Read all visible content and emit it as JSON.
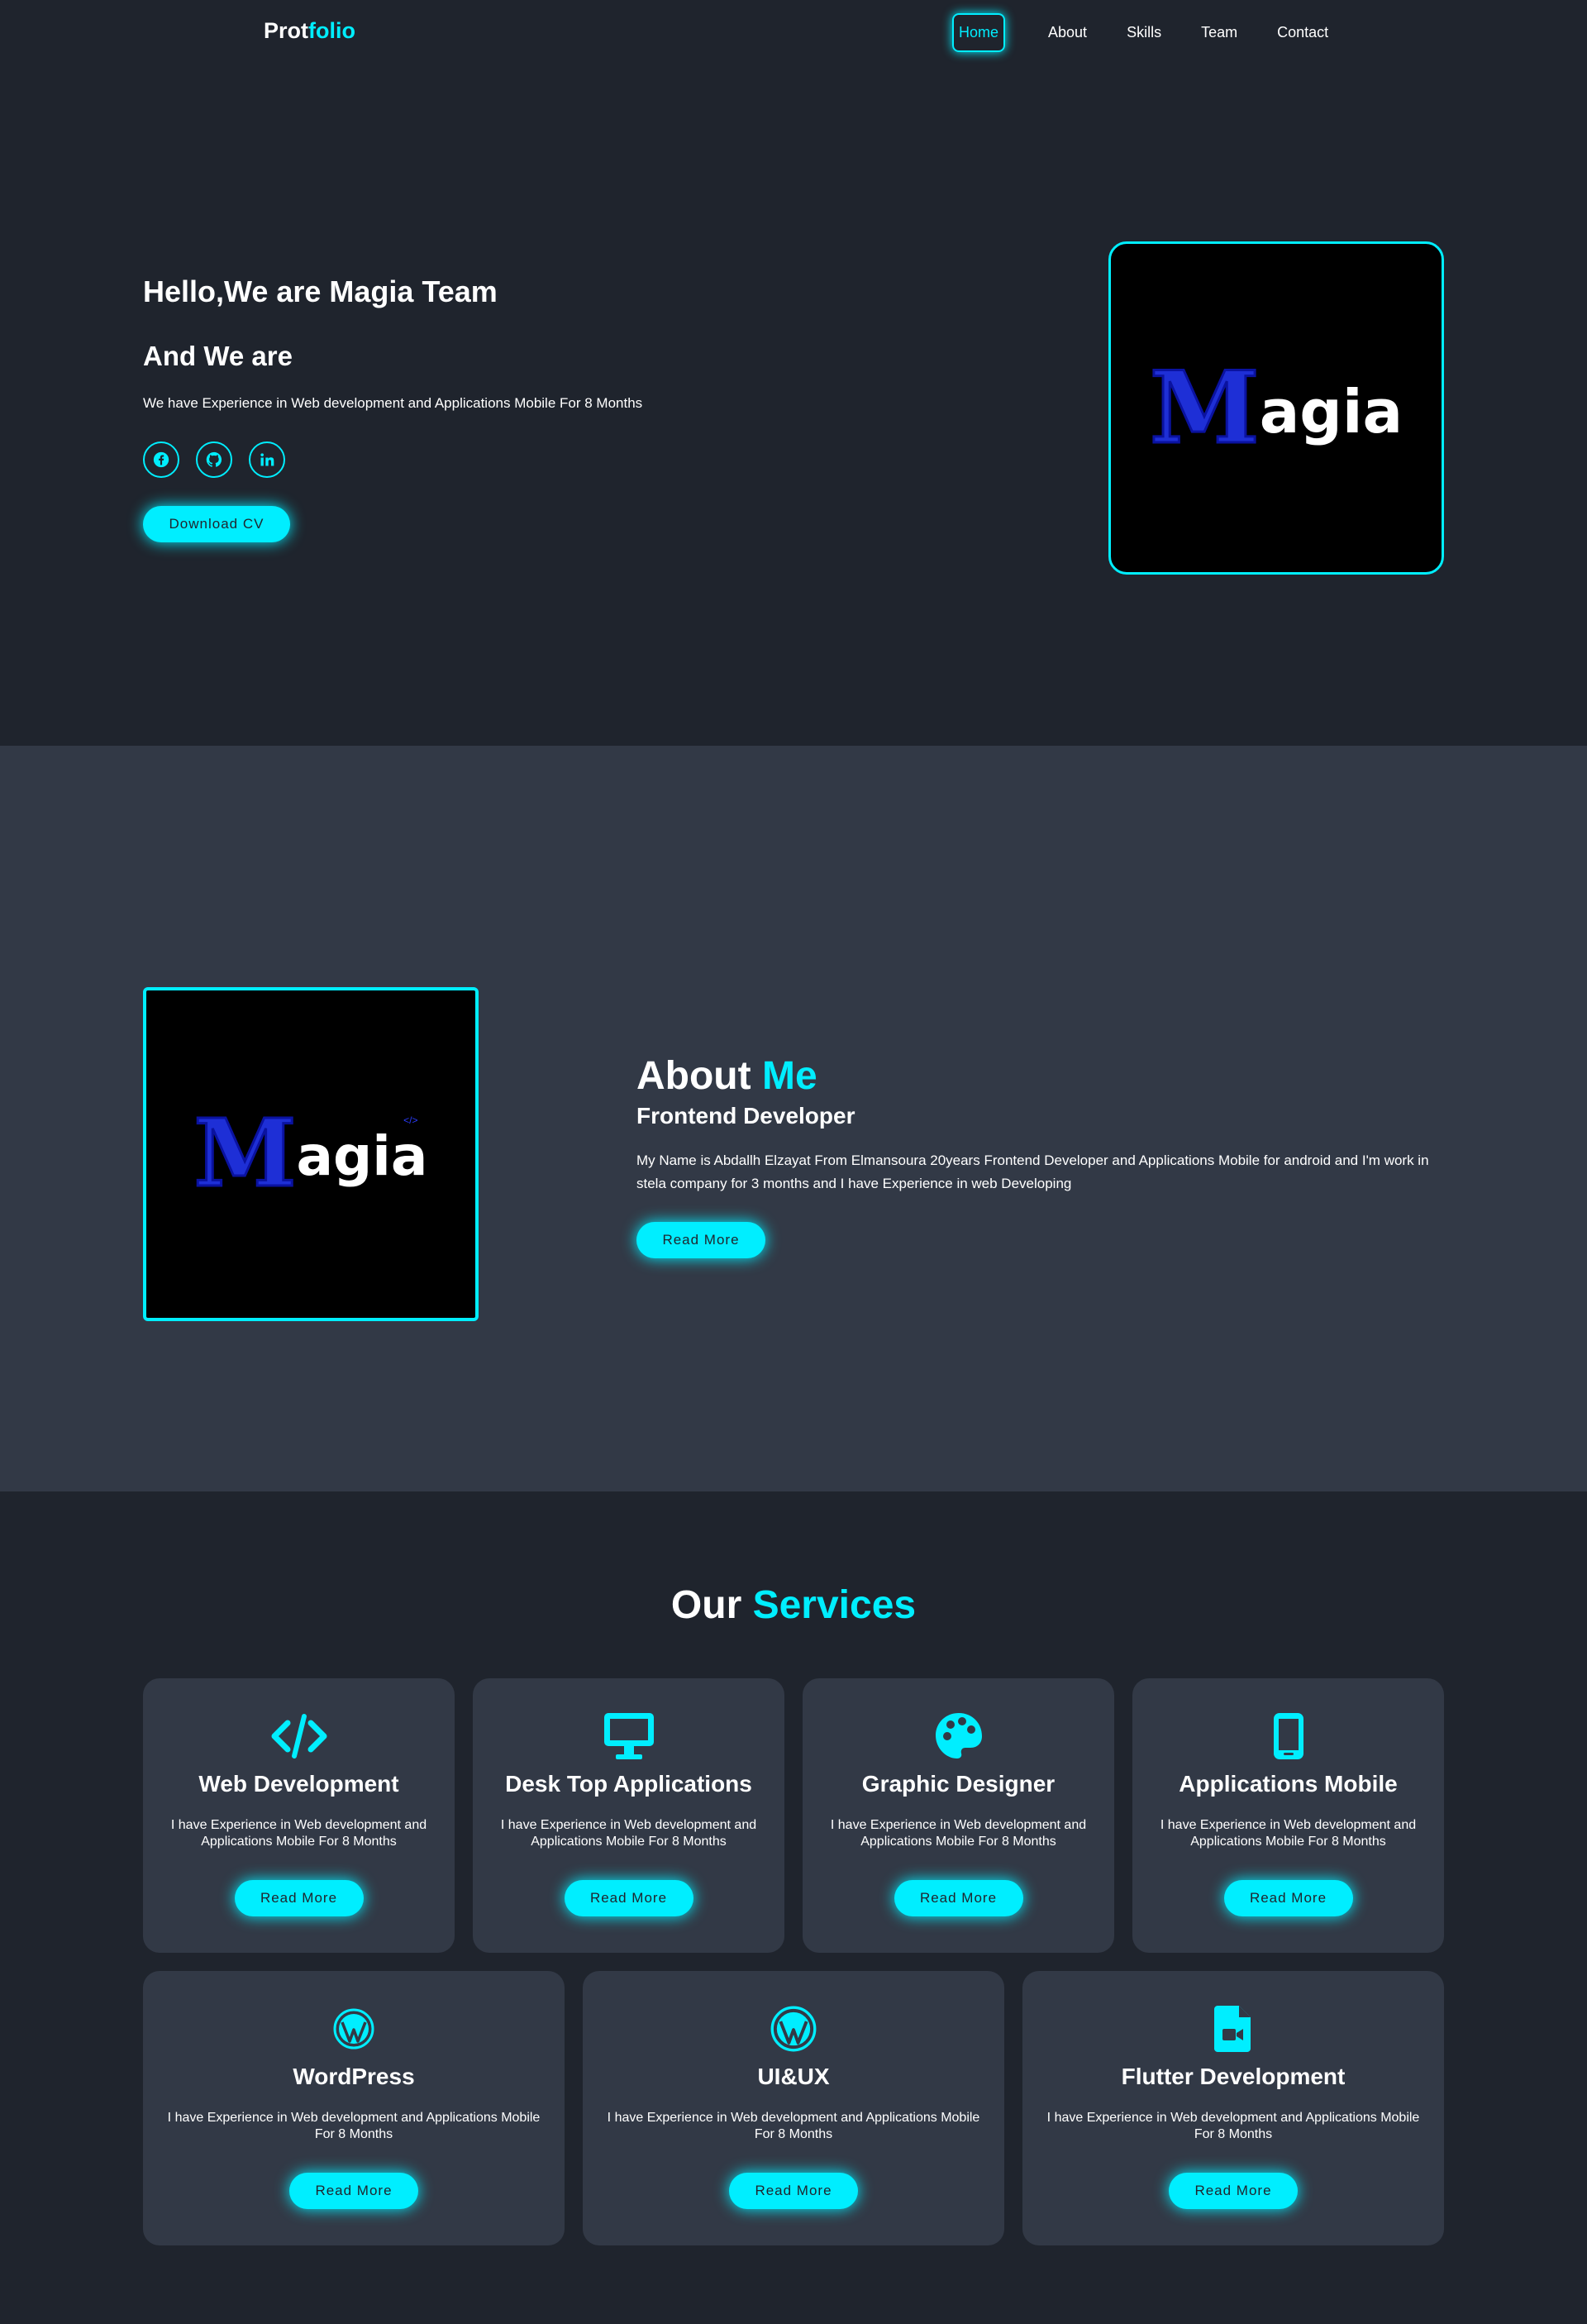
{
  "nav": {
    "logo_prefix": "Prot",
    "logo_accent": "folio",
    "links": [
      "Home",
      "About",
      "Skills",
      "Team",
      "Contact"
    ]
  },
  "hero": {
    "title": "Hello,We are Magia Team",
    "subtitle": "And We are",
    "text": "We have Experience in Web development and Applications Mobile For 8 Months",
    "socials": [
      "facebook-icon",
      "github-icon",
      "linkedin-icon"
    ],
    "button": "Download CV",
    "brand": {
      "m": "M",
      "rest": "agia"
    }
  },
  "about": {
    "title_prefix": "About ",
    "title_accent": "Me",
    "role": "Frontend Developer",
    "text": "My Name is Abdallh Elzayat From Elmansoura 20years Frontend Developer and Applications Mobile for android and I'm work in stela company for 3 months and I have Experience in web Developing",
    "button": "Read More",
    "brand": {
      "m": "M",
      "rest": "agia",
      "tag": "</>"
    }
  },
  "services": {
    "title_prefix": "Our ",
    "title_accent": "Services",
    "cards": [
      {
        "title": "Web Development",
        "text": "I have Experience in Web development and Applications Mobile For 8 Months",
        "button": "Read More",
        "icon": "code-icon"
      },
      {
        "title": "Desk Top Applications",
        "text": "I have Experience in Web development and Applications Mobile For 8 Months",
        "button": "Read More",
        "icon": "desktop-icon"
      },
      {
        "title": "Graphic Designer",
        "text": "I have Experience in Web development and Applications Mobile For 8 Months",
        "button": "Read More",
        "icon": "palette-icon"
      },
      {
        "title": "Applications Mobile",
        "text": "I have Experience in Web development and Applications Mobile For 8 Months",
        "button": "Read More",
        "icon": "mobile-icon"
      },
      {
        "title": "WordPress",
        "text": "I have Experience in Web development and Applications Mobile For 8 Months",
        "button": "Read More",
        "icon": "wordpress-icon"
      },
      {
        "title": "UI&UX",
        "text": "I have Experience in Web development and Applications Mobile For 8 Months",
        "button": "Read More",
        "icon": "wordpress-icon"
      },
      {
        "title": "Flutter Development",
        "text": "I have Experience in Web development and Applications Mobile For 8 Months",
        "button": "Read More",
        "icon": "file-video-icon"
      }
    ]
  },
  "colors": {
    "accent": "#00eeff",
    "bg": "#1f242d",
    "bg_alt": "#323946",
    "brand_blue": "#1e2fd6"
  }
}
